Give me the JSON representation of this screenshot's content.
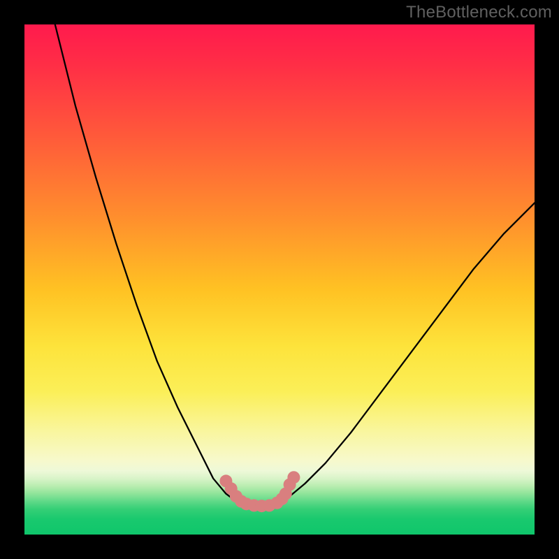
{
  "attribution": "TheBottleneck.com",
  "chart_data": {
    "type": "line",
    "title": "",
    "xlabel": "",
    "ylabel": "",
    "ylim": [
      0,
      100
    ],
    "xlim": [
      0,
      100
    ],
    "note": "Two curves descending to a minimum then rising, against a red→green gradient background. No axis ticks or numeric labels are visible; x/y values are estimated pixel-relative (0–100).",
    "series": [
      {
        "name": "left-curve",
        "x": [
          6,
          10,
          14,
          18,
          22,
          26,
          30,
          34,
          37,
          39.5,
          41.5,
          43.5
        ],
        "y": [
          100,
          84,
          70,
          57,
          45,
          34,
          25,
          17,
          11,
          8,
          6.5,
          6
        ]
      },
      {
        "name": "right-curve",
        "x": [
          50,
          52,
          55,
          59,
          64,
          70,
          76,
          82,
          88,
          94,
          100
        ],
        "y": [
          6,
          7.5,
          10,
          14,
          20,
          28,
          36,
          44,
          52,
          59,
          65
        ]
      },
      {
        "name": "floor-segment",
        "x": [
          43.5,
          46,
          48,
          50
        ],
        "y": [
          6,
          5.5,
          5.5,
          6
        ]
      }
    ],
    "markers": {
      "name": "salmon-dots",
      "color": "#d97f7f",
      "points_xy": [
        [
          39.5,
          10.5
        ],
        [
          40.5,
          9
        ],
        [
          41.5,
          7.5
        ],
        [
          42.5,
          6.5
        ],
        [
          43.5,
          6
        ],
        [
          45,
          5.7
        ],
        [
          46.5,
          5.6
        ],
        [
          48,
          5.7
        ],
        [
          49.5,
          6.2
        ],
        [
          50.5,
          7
        ],
        [
          51.2,
          8
        ],
        [
          52,
          9.8
        ],
        [
          52.8,
          11.2
        ]
      ]
    },
    "background_gradient": {
      "stops": [
        {
          "pos": 0,
          "color": "#ff1a4d"
        },
        {
          "pos": 40,
          "color": "#ff9a2d"
        },
        {
          "pos": 70,
          "color": "#fbef58"
        },
        {
          "pos": 88,
          "color": "#f7f9cc"
        },
        {
          "pos": 100,
          "color": "#0fc66b"
        }
      ]
    }
  }
}
